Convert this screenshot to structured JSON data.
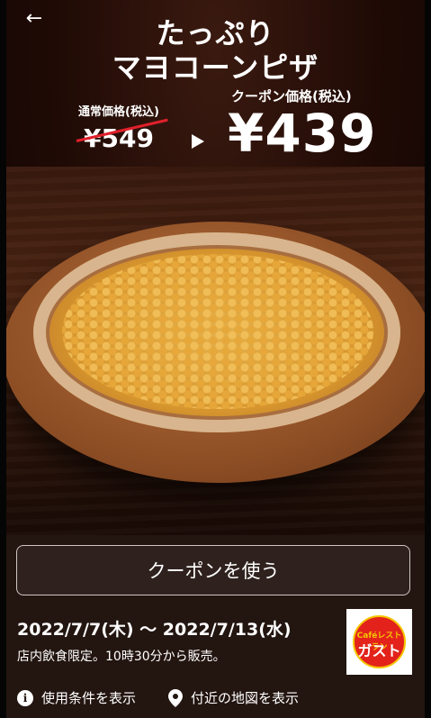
{
  "header": {
    "back_icon": "←",
    "title_line1": "たっぷり",
    "title_line2": "マヨコーンピザ"
  },
  "prices": {
    "regular_label": "通常価格(税込)",
    "regular_price": "¥549",
    "coupon_label": "クーポン価格(税込)",
    "coupon_price": "¥439"
  },
  "panel": {
    "use_button_label": "クーポンを使う",
    "dates": "2022/7/7(木) 〜 2022/7/13(水)",
    "note": "店内飲食限定。10時30分から販売。",
    "logo": {
      "small": "Caféレストラン",
      "main": "ガスト"
    },
    "links": {
      "terms": "使用条件を表示",
      "map": "付近の地図を表示"
    }
  },
  "colors": {
    "panel_bg": "#231510",
    "strike": "#e0202a",
    "logo_red": "#e3231b",
    "logo_yellow": "#f5c600"
  }
}
